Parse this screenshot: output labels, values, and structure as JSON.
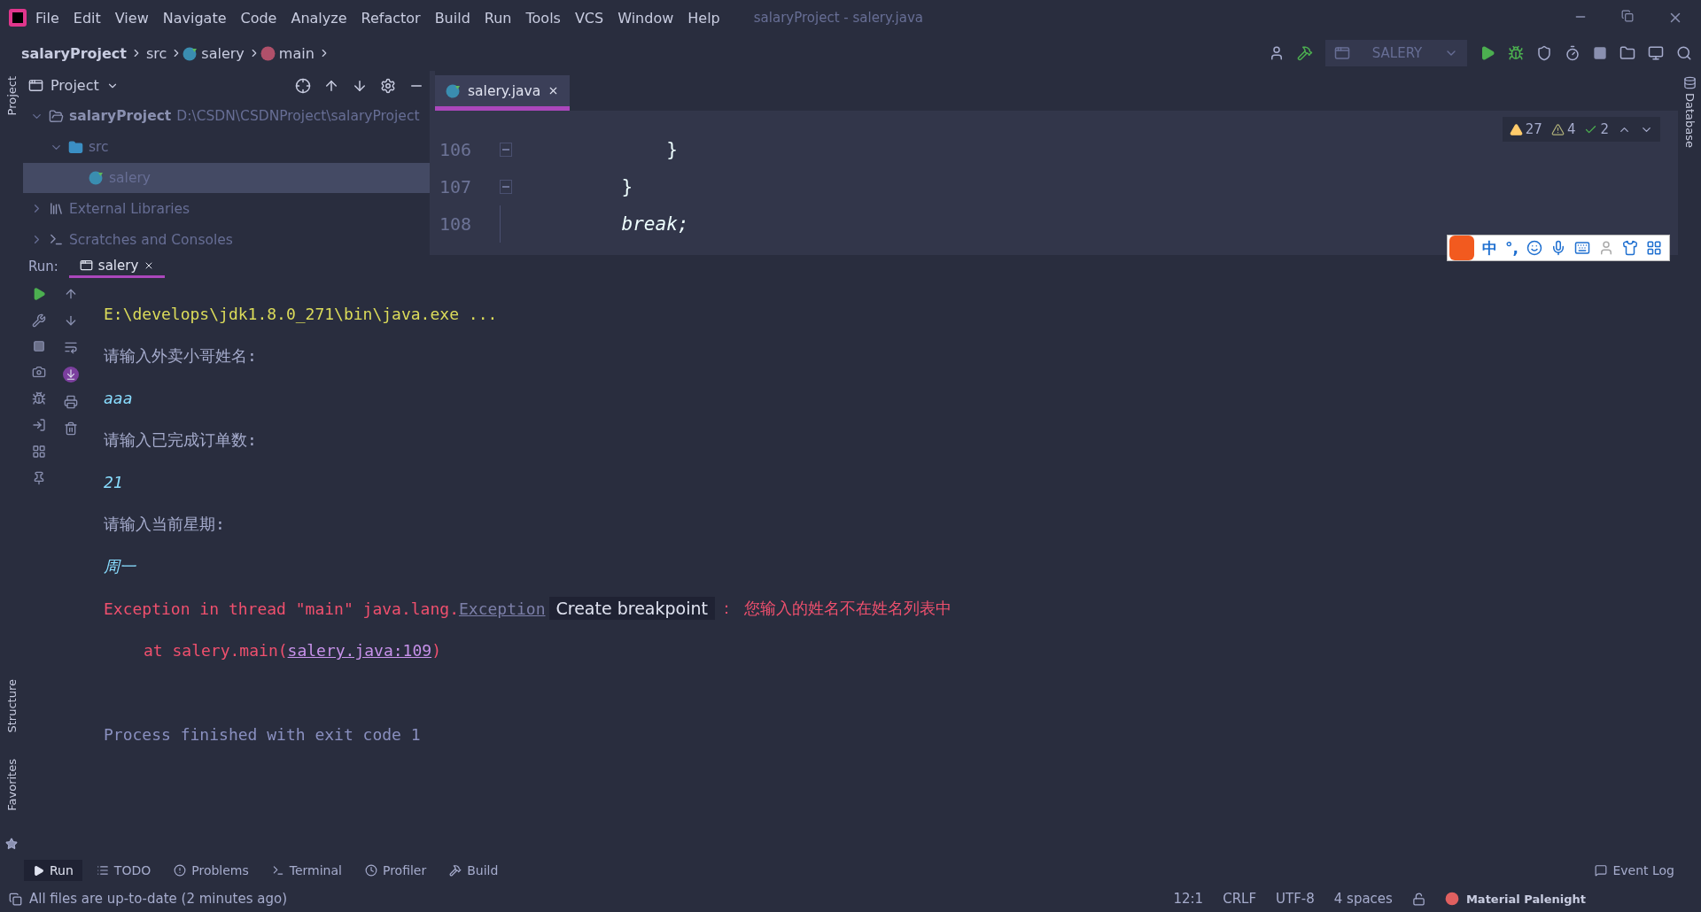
{
  "menu": [
    "File",
    "Edit",
    "View",
    "Navigate",
    "Code",
    "Analyze",
    "Refactor",
    "Build",
    "Run",
    "Tools",
    "VCS",
    "Window",
    "Help"
  ],
  "window_title": "salaryProject - salery.java",
  "breadcrumb": [
    {
      "label": "salaryProject",
      "kind": "project"
    },
    {
      "label": "src",
      "kind": "folder"
    },
    {
      "label": "salery",
      "kind": "class"
    },
    {
      "label": "main",
      "kind": "method"
    }
  ],
  "run_config": "SALERY",
  "left_strip": {
    "top": "Project",
    "bottom": [
      "Structure",
      "Favorites"
    ]
  },
  "right_strip": "Database",
  "project_panel": {
    "title": "Project",
    "tree": [
      {
        "label": "salaryProject",
        "path": "D:\\CSDN\\CSDNProject\\salaryProject",
        "kind": "project",
        "expanded": true,
        "selected": false,
        "children": [
          {
            "label": "src",
            "kind": "folder",
            "expanded": true,
            "selected": false,
            "children": [
              {
                "label": "salery",
                "kind": "class",
                "selected": true
              }
            ]
          }
        ]
      },
      {
        "label": "External Libraries",
        "kind": "libraries",
        "expanded": false,
        "selected": false
      },
      {
        "label": "Scratches and Consoles",
        "kind": "scratches",
        "expanded": false,
        "selected": false
      }
    ]
  },
  "editor": {
    "tabs": [
      {
        "label": "salery.java",
        "selected": true
      }
    ],
    "lines": [
      {
        "number": "106",
        "code": "        }",
        "fold": true,
        "italic": false
      },
      {
        "number": "107",
        "code": "    }",
        "fold": true,
        "italic": false
      },
      {
        "number": "108",
        "code": "    break;",
        "fold": false,
        "italic": true
      }
    ],
    "inspections": [
      {
        "kind": "warning",
        "count": "27"
      },
      {
        "kind": "weak",
        "count": "4"
      },
      {
        "kind": "typo",
        "count": "2"
      }
    ]
  },
  "ime_bar": {
    "mode": "中",
    "punct": "°,"
  },
  "run": {
    "label": "Run:",
    "tabs": [
      {
        "label": "salery",
        "selected": true
      }
    ],
    "console": [
      {
        "kind": "command",
        "text": "E:\\develops\\jdk1.8.0_271\\bin\\java.exe ..."
      },
      {
        "kind": "output",
        "text": "请输入外卖小哥姓名:"
      },
      {
        "kind": "input",
        "text": "aaa"
      },
      {
        "kind": "output",
        "text": "请输入已完成订单数:"
      },
      {
        "kind": "input",
        "text": "21"
      },
      {
        "kind": "output",
        "text": "请输入当前星期:"
      },
      {
        "kind": "input",
        "text": "周一"
      },
      {
        "kind": "error",
        "text": "Exception in thread \"main\" java.lang.",
        "link": "Exception",
        "tooltip": "Create breakpoint",
        "rest": "： 您输入的姓名不在姓名列表中"
      },
      {
        "kind": "stack",
        "text": "at salery.main(",
        "link": "salery.java:109",
        "rest": ")"
      },
      {
        "kind": "blank"
      },
      {
        "kind": "exit",
        "text": "Process finished with exit code 1"
      }
    ]
  },
  "tool_tabs": [
    {
      "label": "Run",
      "kind": "run",
      "selected": true
    },
    {
      "label": "TODO",
      "kind": "todo",
      "selected": false
    },
    {
      "label": "Problems",
      "kind": "problems",
      "selected": false
    },
    {
      "label": "Terminal",
      "kind": "terminal",
      "selected": false
    },
    {
      "label": "Profiler",
      "kind": "profiler",
      "selected": false
    },
    {
      "label": "Build",
      "kind": "build",
      "selected": false
    }
  ],
  "event_log": "Event Log",
  "status": {
    "message": "All files are up-to-date (2 minutes ago)",
    "items": [
      "12:1",
      "CRLF",
      "UTF-8",
      "4 spaces"
    ],
    "theme": "Material Palenight"
  }
}
